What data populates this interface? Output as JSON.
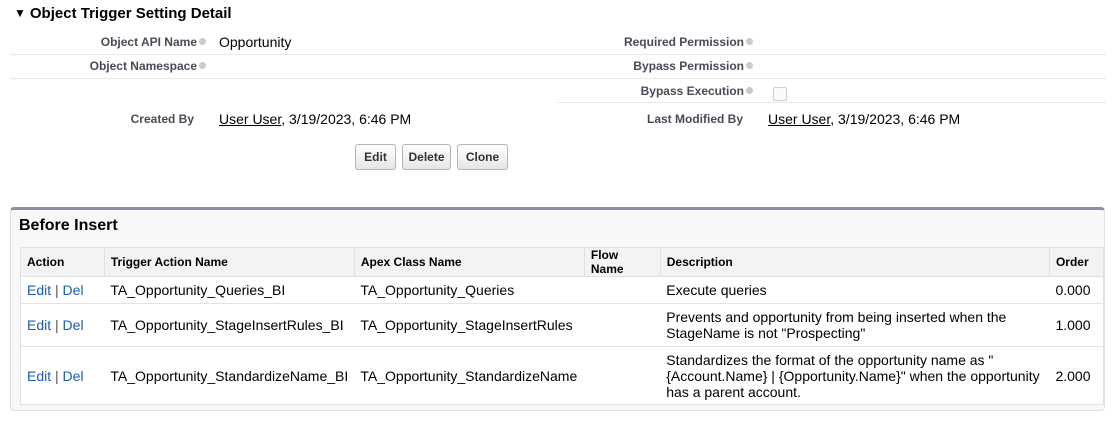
{
  "section_title": "Object Trigger Setting Detail",
  "fields": {
    "object_api_name_label": "Object API Name",
    "object_api_name_value": "Opportunity",
    "object_namespace_label": "Object Namespace",
    "required_permission_label": "Required Permission",
    "bypass_permission_label": "Bypass Permission",
    "bypass_execution_label": "Bypass Execution",
    "bypass_execution_checked": false,
    "created_by_label": "Created By",
    "created_by_user": "User User",
    "created_by_date": ", 3/19/2023, 6:46 PM",
    "last_modified_by_label": "Last Modified By",
    "last_modified_by_user": "User User",
    "last_modified_by_date": ", 3/19/2023, 6:46 PM"
  },
  "buttons": {
    "edit": "Edit",
    "delete": "Delete",
    "clone": "Clone"
  },
  "before_insert": {
    "title": "Before Insert",
    "columns": [
      "Action",
      "Trigger Action Name",
      "Apex Class Name",
      "Flow Name",
      "Description",
      "Order"
    ],
    "action_edit": "Edit",
    "action_sep": "|",
    "action_del": "Del",
    "rows": [
      {
        "trigger_action_name": "TA_Opportunity_Queries_BI",
        "apex_class_name": "TA_Opportunity_Queries",
        "flow_name": "",
        "description": "Execute queries",
        "order": "0.000"
      },
      {
        "trigger_action_name": "TA_Opportunity_StageInsertRules_BI",
        "apex_class_name": "TA_Opportunity_StageInsertRules",
        "flow_name": "",
        "description": "Prevents and opportunity from being inserted when the StageName is not \"Prospecting\"",
        "order": "1.000"
      },
      {
        "trigger_action_name": "TA_Opportunity_StandardizeName_BI",
        "apex_class_name": "TA_Opportunity_StandardizeName",
        "flow_name": "",
        "description": "Standardizes the format of the opportunity name as \" {Account.Name} | {Opportunity.Name}\" when the opportunity has a parent account.",
        "order": "2.000"
      }
    ]
  }
}
